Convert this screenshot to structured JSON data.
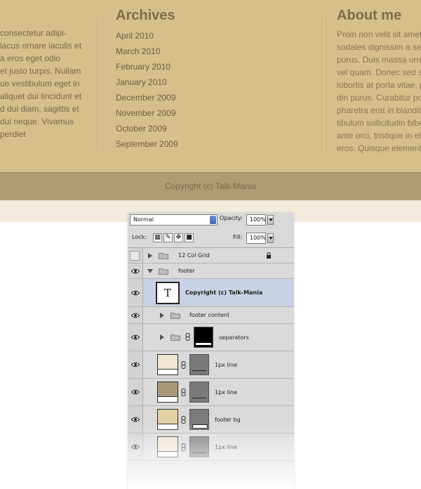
{
  "footer": {
    "intro_lines": [
      "consectetur adipi-",
      "lacus ornare iaculis et",
      "a eros eget odio",
      "et justo turpis. Nullam",
      "ue vestibulum eget in",
      "aliquet dui tincidunt et",
      "d dui diam, sagittis et",
      "dui neque. Vivamus",
      "perdiet"
    ],
    "archives": {
      "heading": "Archives",
      "links": [
        "April 2010",
        "March 2010",
        "February 2010",
        "January 2010",
        "December 2009",
        "November 2009",
        "October 2009",
        "September 2009"
      ]
    },
    "about": {
      "heading": "About me",
      "lines": [
        "Proin non velit sit amet",
        "sodales dignissim a se",
        "purus. Duis massa urn",
        "vel quam. Donec sed s",
        "lobortis at porta vitae, p",
        "din purus. Curabitur po",
        "pharetra erat in blandit",
        "tibulum sollicitudin bibe",
        "ante orci, tristique in el",
        "eros. Quisque element"
      ]
    },
    "copyright": "Copyright (c) Talk-Mania",
    "colors": {
      "footer_bg": "#d7bf8c",
      "copyright_bar": "#b19b72",
      "cream_strip": "#f3ebdd"
    }
  },
  "layers_panel": {
    "blend_mode": "Normal",
    "opacity_label": "Opacity:",
    "opacity_value": "100%",
    "lock_label": "Lock:",
    "fill_label": "Fill:",
    "fill_value": "100%",
    "layers": [
      {
        "name": "12 Col Grid",
        "type": "group",
        "visible": false,
        "expanded": false,
        "locked": true
      },
      {
        "name": "footer",
        "type": "group",
        "visible": true,
        "expanded": true
      },
      {
        "name": "Copyright (c) Talk-Mania",
        "type": "text",
        "visible": true,
        "selected": true,
        "thumb_label": "T"
      },
      {
        "name": "footer content",
        "type": "group",
        "visible": true,
        "expanded": false
      },
      {
        "name": "separators",
        "type": "group",
        "visible": true,
        "expanded": false,
        "has_mask": true
      },
      {
        "name": "1px line",
        "type": "shape",
        "visible": true,
        "swatch": "#efe5d0"
      },
      {
        "name": "1px line",
        "type": "shape",
        "visible": true,
        "swatch": "#a89877"
      },
      {
        "name": "footer bg",
        "type": "shape",
        "visible": true,
        "swatch": "#e3d0a5"
      },
      {
        "name": "1px line",
        "type": "shape",
        "visible": true,
        "swatch": "#efe5d0"
      }
    ]
  }
}
